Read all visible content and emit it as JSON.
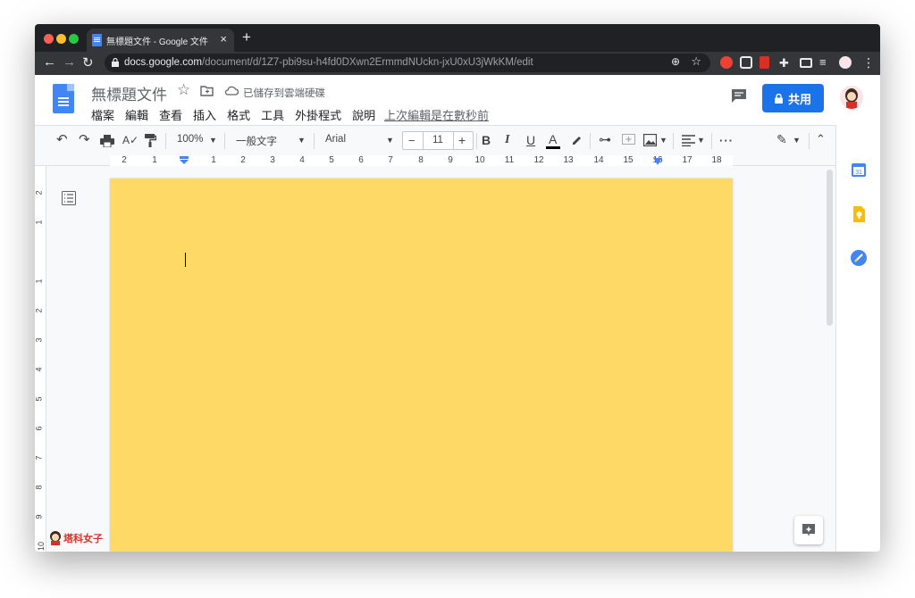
{
  "browser": {
    "tab_title": "無標題文件 - Google 文件",
    "tab_close": "×",
    "new_tab": "+",
    "url_host": "docs.google.com",
    "url_path": "/document/d/1Z7-pbi9su-h4fd0DXwn2ErmmdNUckn-jxU0xU3jWkKM/edit"
  },
  "docs": {
    "title": "無標題文件",
    "save_status": "已儲存到雲端硬碟",
    "menu": [
      "檔案",
      "編輯",
      "查看",
      "插入",
      "格式",
      "工具",
      "外掛程式",
      "說明"
    ],
    "last_edit": "上次編輯是在數秒前",
    "share_label": "共用"
  },
  "toolbar": {
    "zoom": "100%",
    "style": "一般文字",
    "font": "Arial",
    "font_size": "11",
    "minus": "−",
    "plus": "+",
    "bold": "B",
    "italic": "I",
    "underline": "U",
    "text_color": "A",
    "more": "···"
  },
  "ruler": {
    "labels": [
      "2",
      "1",
      "1",
      "2",
      "3",
      "4",
      "5",
      "6",
      "7",
      "8",
      "9",
      "10",
      "11",
      "12",
      "13",
      "14",
      "15",
      "16",
      "17",
      "18"
    ],
    "vlabels": [
      "2",
      "1",
      "1",
      "2",
      "3",
      "4",
      "5",
      "6",
      "7",
      "8",
      "9",
      "10"
    ]
  },
  "watermark": "塔科女子",
  "colors": {
    "page_background": "#fed966",
    "accent": "#1a73e8"
  }
}
